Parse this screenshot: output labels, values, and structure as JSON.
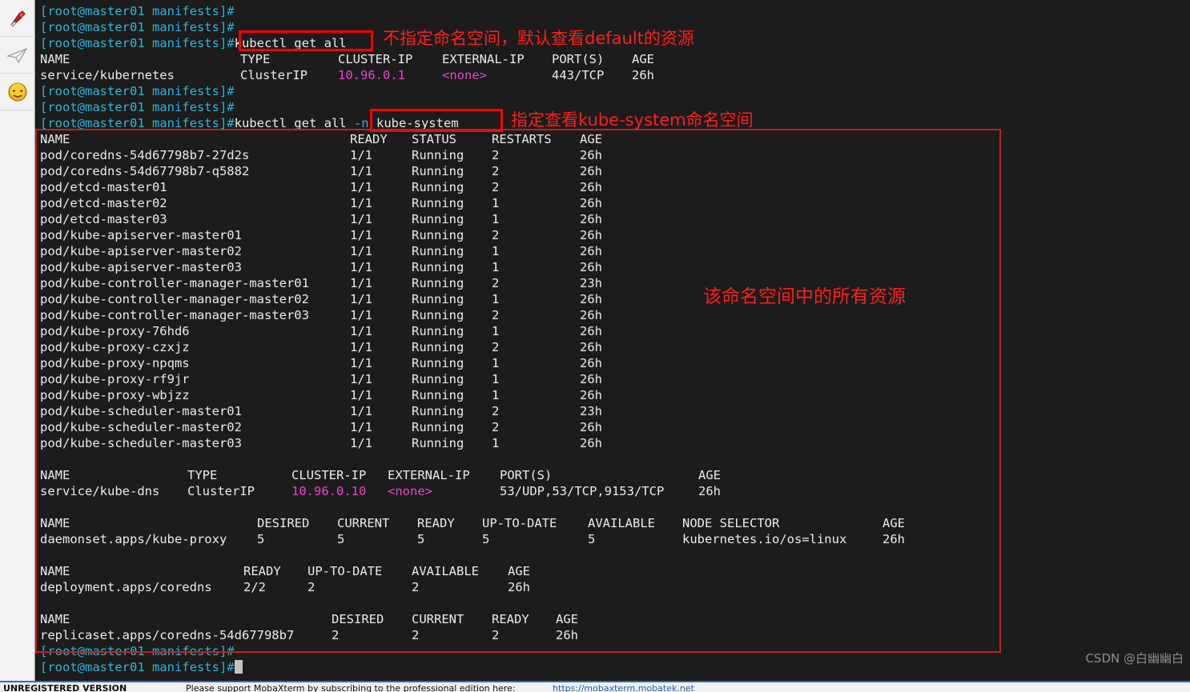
{
  "sidebar": {
    "items": [
      {
        "name": "tools-icon",
        "title": "Tools"
      },
      {
        "name": "send-icon",
        "title": "Send"
      },
      {
        "name": "smiley-icon",
        "title": "Emoticons"
      }
    ]
  },
  "terminal": {
    "prompt": "[root@master01 manifests]",
    "hash": "#",
    "lines": [
      {
        "type": "prompt",
        "prompt": "[root@master01 manifests]",
        "cmd": "#"
      },
      {
        "type": "prompt",
        "prompt": "[root@master01 manifests]",
        "cmd": "#"
      },
      {
        "type": "prompt",
        "prompt": "[root@master01 manifests]",
        "cmd": "#kubectl get all"
      },
      {
        "type": "header",
        "text": "NAME                TYPE        CLUSTER-IP   EXTERNAL-IP   PORT(S)   AGE"
      },
      {
        "type": "svcrow",
        "name": "service/kubernetes",
        "stype": "ClusterIP",
        "ip": "10.96.0.1",
        "ext": "<none>",
        "ports": "443/TCP",
        "age": "26h"
      },
      {
        "type": "prompt",
        "prompt": "[root@master01 manifests]",
        "cmd": "#"
      },
      {
        "type": "prompt",
        "prompt": "[root@master01 manifests]",
        "cmd": "#"
      },
      {
        "type": "prompt",
        "prompt": "[root@master01 manifests]",
        "cmd": "#kubectl get all ",
        "flag": "-n",
        "flagval": " kube-system"
      }
    ],
    "cmd1": "kubectl get all",
    "cmd2": "kubectl get all",
    "cmd2_flag": "-n",
    "cmd2_ns": "kube-system"
  },
  "pods": {
    "headers": [
      "NAME",
      "READY",
      "STATUS",
      "RESTARTS",
      "AGE"
    ],
    "rows": [
      {
        "name": "pod/coredns-54d67798b7-27d2s",
        "ready": "1/1",
        "status": "Running",
        "restarts": "2",
        "age": "26h"
      },
      {
        "name": "pod/coredns-54d67798b7-q5882",
        "ready": "1/1",
        "status": "Running",
        "restarts": "2",
        "age": "26h"
      },
      {
        "name": "pod/etcd-master01",
        "ready": "1/1",
        "status": "Running",
        "restarts": "2",
        "age": "26h"
      },
      {
        "name": "pod/etcd-master02",
        "ready": "1/1",
        "status": "Running",
        "restarts": "1",
        "age": "26h"
      },
      {
        "name": "pod/etcd-master03",
        "ready": "1/1",
        "status": "Running",
        "restarts": "1",
        "age": "26h"
      },
      {
        "name": "pod/kube-apiserver-master01",
        "ready": "1/1",
        "status": "Running",
        "restarts": "2",
        "age": "26h"
      },
      {
        "name": "pod/kube-apiserver-master02",
        "ready": "1/1",
        "status": "Running",
        "restarts": "1",
        "age": "26h"
      },
      {
        "name": "pod/kube-apiserver-master03",
        "ready": "1/1",
        "status": "Running",
        "restarts": "1",
        "age": "26h"
      },
      {
        "name": "pod/kube-controller-manager-master01",
        "ready": "1/1",
        "status": "Running",
        "restarts": "2",
        "age": "23h"
      },
      {
        "name": "pod/kube-controller-manager-master02",
        "ready": "1/1",
        "status": "Running",
        "restarts": "1",
        "age": "26h"
      },
      {
        "name": "pod/kube-controller-manager-master03",
        "ready": "1/1",
        "status": "Running",
        "restarts": "2",
        "age": "26h"
      },
      {
        "name": "pod/kube-proxy-76hd6",
        "ready": "1/1",
        "status": "Running",
        "restarts": "1",
        "age": "26h"
      },
      {
        "name": "pod/kube-proxy-czxjz",
        "ready": "1/1",
        "status": "Running",
        "restarts": "2",
        "age": "26h"
      },
      {
        "name": "pod/kube-proxy-npqms",
        "ready": "1/1",
        "status": "Running",
        "restarts": "1",
        "age": "26h"
      },
      {
        "name": "pod/kube-proxy-rf9jr",
        "ready": "1/1",
        "status": "Running",
        "restarts": "1",
        "age": "26h"
      },
      {
        "name": "pod/kube-proxy-wbjzz",
        "ready": "1/1",
        "status": "Running",
        "restarts": "1",
        "age": "26h"
      },
      {
        "name": "pod/kube-scheduler-master01",
        "ready": "1/1",
        "status": "Running",
        "restarts": "2",
        "age": "23h"
      },
      {
        "name": "pod/kube-scheduler-master02",
        "ready": "1/1",
        "status": "Running",
        "restarts": "2",
        "age": "26h"
      },
      {
        "name": "pod/kube-scheduler-master03",
        "ready": "1/1",
        "status": "Running",
        "restarts": "1",
        "age": "26h"
      }
    ]
  },
  "default_service": {
    "headers": [
      "NAME",
      "TYPE",
      "CLUSTER-IP",
      "EXTERNAL-IP",
      "PORT(S)",
      "AGE"
    ],
    "row": {
      "name": "service/kubernetes",
      "type": "ClusterIP",
      "cluster_ip": "10.96.0.1",
      "external_ip": "<none>",
      "ports": "443/TCP",
      "age": "26h"
    }
  },
  "service": {
    "headers": [
      "NAME",
      "TYPE",
      "CLUSTER-IP",
      "EXTERNAL-IP",
      "PORT(S)",
      "AGE"
    ],
    "row": {
      "name": "service/kube-dns",
      "type": "ClusterIP",
      "cluster_ip": "10.96.0.10",
      "external_ip": "<none>",
      "ports": "53/UDP,53/TCP,9153/TCP",
      "age": "26h"
    }
  },
  "daemonset": {
    "headers": [
      "NAME",
      "DESIRED",
      "CURRENT",
      "READY",
      "UP-TO-DATE",
      "AVAILABLE",
      "NODE SELECTOR",
      "AGE"
    ],
    "row": {
      "name": "daemonset.apps/kube-proxy",
      "desired": "5",
      "current": "5",
      "ready": "5",
      "uptodate": "5",
      "available": "5",
      "selector": "kubernetes.io/os=linux",
      "age": "26h"
    }
  },
  "deployment": {
    "headers": [
      "NAME",
      "READY",
      "UP-TO-DATE",
      "AVAILABLE",
      "AGE"
    ],
    "row": {
      "name": "deployment.apps/coredns",
      "ready": "2/2",
      "uptodate": "2",
      "available": "2",
      "age": "26h"
    }
  },
  "replicaset": {
    "headers": [
      "NAME",
      "DESIRED",
      "CURRENT",
      "READY",
      "AGE"
    ],
    "row": {
      "name": "replicaset.apps/coredns-54d67798b7",
      "desired": "2",
      "current": "2",
      "ready": "2",
      "age": "26h"
    }
  },
  "annotations": {
    "note1": "不指定命名空间，默认查看default的资源",
    "note2": "指定查看kube-system命名空间",
    "note3": "该命名空间中的所有资源"
  },
  "watermark": "CSDN @白幽幽白",
  "statusbar": {
    "label": "UNREGISTERED VERSION",
    "message": "Please support MobaXterm by subscribing to the professional edition here:",
    "link": "https://mobaxterm.mobatek.net"
  }
}
